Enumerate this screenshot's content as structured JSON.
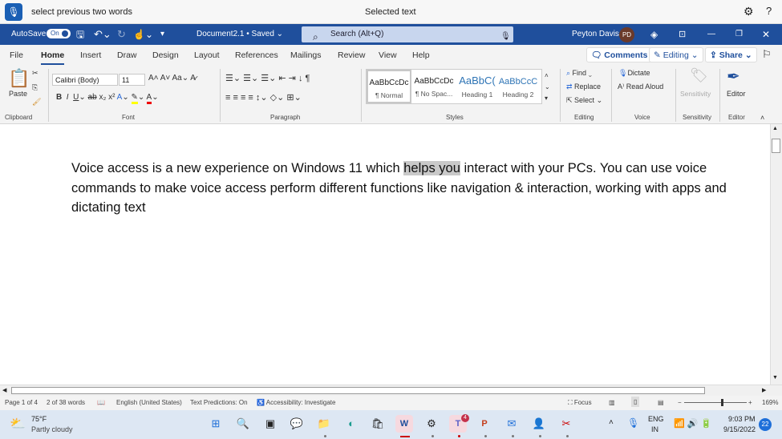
{
  "voice": {
    "command": "select previous two words",
    "status": "Selected text",
    "icon": "microphone-icon"
  },
  "titlebar": {
    "autosave": "AutoSave",
    "toggle": "On",
    "document": "Document2.1 • Saved ⌄",
    "search": "Search (Alt+Q)",
    "user": "Peyton Davis",
    "initials": "PD"
  },
  "tabs": [
    "File",
    "Home",
    "Insert",
    "Draw",
    "Design",
    "Layout",
    "References",
    "Mailings",
    "Review",
    "View",
    "Help"
  ],
  "ribbon_buttons": {
    "comments": "Comments",
    "editing": "Editing",
    "share": "Share"
  },
  "ribbon": {
    "clipboard": {
      "paste": "Paste",
      "label": "Clipboard"
    },
    "font": {
      "name": "Calibri (Body)",
      "size": "11",
      "label": "Font"
    },
    "paragraph": {
      "label": "Paragraph"
    },
    "styles": {
      "label": "Styles",
      "items": [
        {
          "preview": "AaBbCcDc",
          "name": "¶ Normal"
        },
        {
          "preview": "AaBbCcDc",
          "name": "¶ No Spac..."
        },
        {
          "preview": "AaBbC(",
          "name": "Heading 1"
        },
        {
          "preview": "AaBbCcC",
          "name": "Heading 2"
        }
      ]
    },
    "editing": {
      "find": "Find",
      "replace": "Replace",
      "select": "Select",
      "label": "Editing"
    },
    "voice": {
      "dictate": "Dictate",
      "read_aloud": "Read Aloud",
      "label": "Voice"
    },
    "sensitivity": {
      "button": "Sensitivity",
      "label": "Sensitivity"
    },
    "editor": {
      "button": "Editor",
      "label": "Editor"
    }
  },
  "document": {
    "before": "Voice access is a new experience on Windows 11 which ",
    "selected": "helps you",
    "after": " interact with your PCs. You can use voice commands to make voice access perform different functions like navigation & interaction, working with apps and dictating text"
  },
  "status": {
    "page": "Page 1 of 4",
    "words": "2 of 38 words",
    "language": "English (United States)",
    "predictions": "Text Predictions: On",
    "accessibility": "Accessibility: Investigate",
    "focus": "Focus",
    "zoom": "169%",
    "zoom_percent": 169
  },
  "taskbar": {
    "temp": "75°F",
    "weather": "Partly cloudy",
    "lang1": "ENG",
    "lang2": "IN",
    "time": "9:03 PM",
    "date": "9/15/2022",
    "notifications": "22",
    "teams_badge": "4"
  },
  "colors": {
    "accent": "#1f4f9c",
    "selection": "#c9c9c9"
  }
}
